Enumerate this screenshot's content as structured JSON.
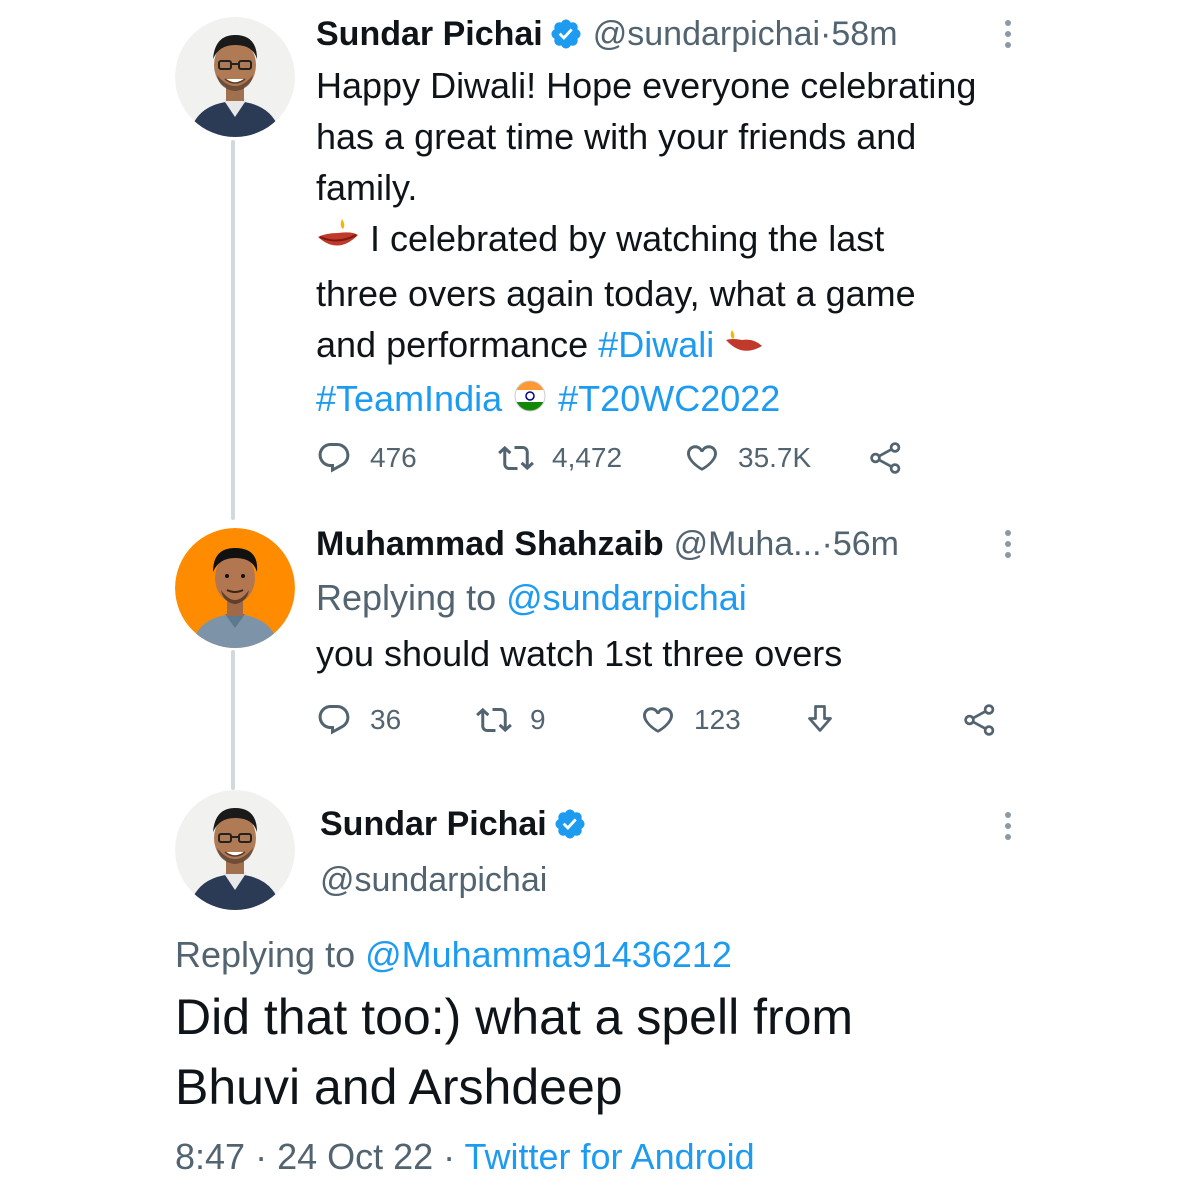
{
  "tweet1": {
    "name": "Sundar Pichai",
    "handle": "@sundarpichai",
    "sep": " · ",
    "time": "58m",
    "text_line1": "Happy Diwali! Hope everyone celebrating",
    "text_line2": "has a great time with your friends and",
    "text_line3": "family.",
    "text_line4": " I celebrated by watching the last",
    "text_line5": "three overs again today, what a game",
    "text_line6_pre": "and performance ",
    "hashtag_diwali": "#Diwali",
    "hashtag_teamindia": "#TeamIndia",
    "hashtag_t20": "#T20WC2022",
    "replies": "476",
    "retweets": "4,472",
    "likes": "35.7K"
  },
  "tweet2": {
    "name": "Muhammad Shahzaib",
    "handle": "@Muha...",
    "sep": " · ",
    "time": "56m",
    "replying_label": "Replying to ",
    "replying_handle": "@sundarpichai",
    "text": "you should watch 1st three overs",
    "replies": "36",
    "retweets": "9",
    "likes": "123"
  },
  "tweet3": {
    "name": "Sundar Pichai",
    "handle": "@sundarpichai",
    "replying_label": "Replying to ",
    "replying_handle": "@Muhamma91436212",
    "text_line1": "Did that too:) what a spell from",
    "text_line2": "Bhuvi and Arshdeep",
    "time": "8:47",
    "sep1": " · ",
    "date": "24 Oct 22",
    "sep2": " · ",
    "source": "Twitter for Android"
  },
  "icons": {
    "reply": "reply-icon",
    "retweet": "retweet-icon",
    "like": "heart-icon",
    "share": "share-icon",
    "download": "download-icon",
    "verified": "verified-badge-icon",
    "more": "more-options-icon"
  },
  "colors": {
    "link": "#1d9bf0",
    "muted": "#536471",
    "text": "#0f1419",
    "verified": "#1d9bf0"
  }
}
